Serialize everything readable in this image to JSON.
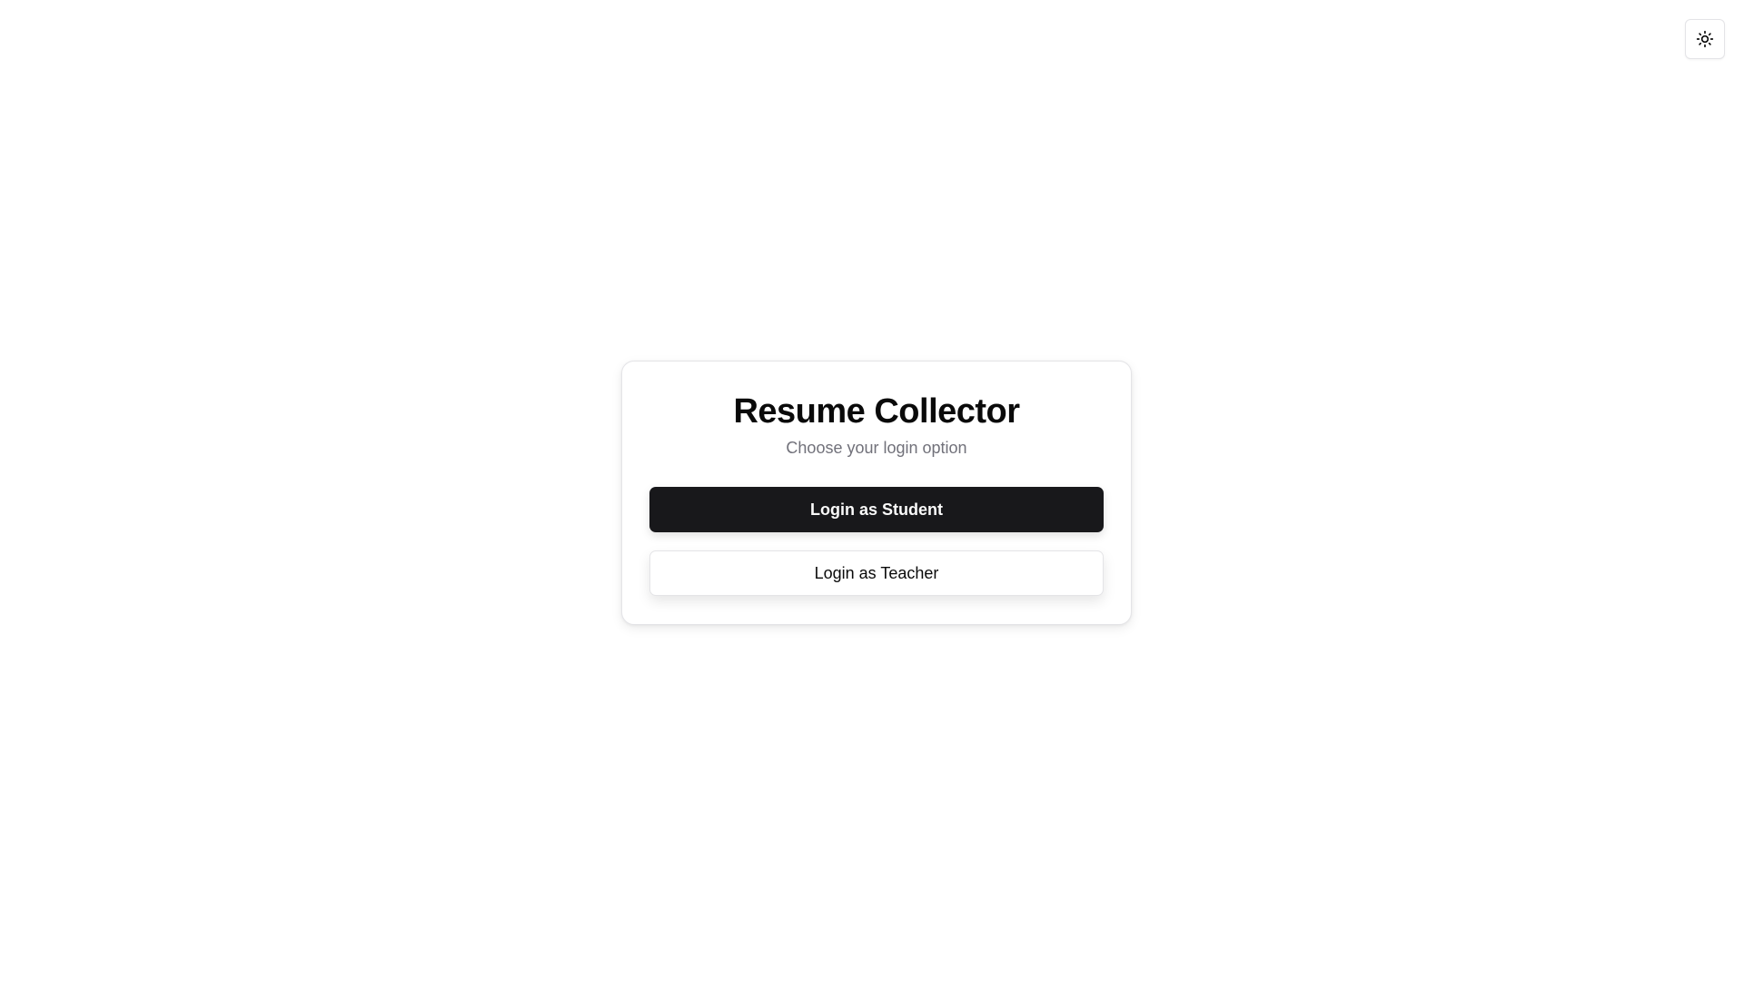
{
  "theme_toggle": {
    "icon": "sun-icon"
  },
  "login_card": {
    "title": "Resume Collector",
    "subtitle": "Choose your login option",
    "student_button_label": "Login as Student",
    "teacher_button_label": "Login as Teacher"
  },
  "colors": {
    "primary_button_bg": "#18181b",
    "primary_button_text": "#fafafa",
    "subtitle_text": "#71717a",
    "border": "#e4e4e7",
    "background": "#ffffff"
  }
}
